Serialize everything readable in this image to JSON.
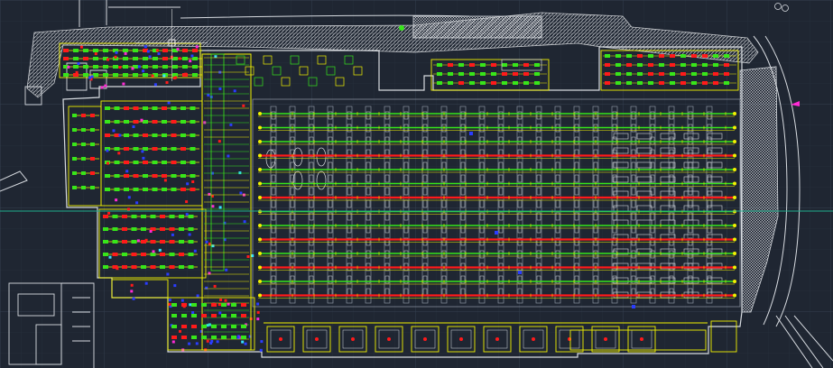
{
  "canvas": {
    "background": "#1f2632",
    "grid_minor": "#2a3341",
    "grid_major": "#344050",
    "crosshair": "#1fae8c"
  },
  "colors": {
    "wall": "#d7dbe0",
    "hatch": "#c9ccd0",
    "yellow": "#f2f200",
    "green": "#37e61a",
    "red": "#ff1a1a",
    "blue": "#2a3cff",
    "magenta": "#ff2ad4",
    "cyan": "#35e0ff",
    "dim": "#8a93a0"
  },
  "plan": {
    "long_rows": {
      "count": 14,
      "red_rows": [
        3,
        6,
        9,
        11,
        13
      ]
    },
    "loading_docks": 11
  }
}
